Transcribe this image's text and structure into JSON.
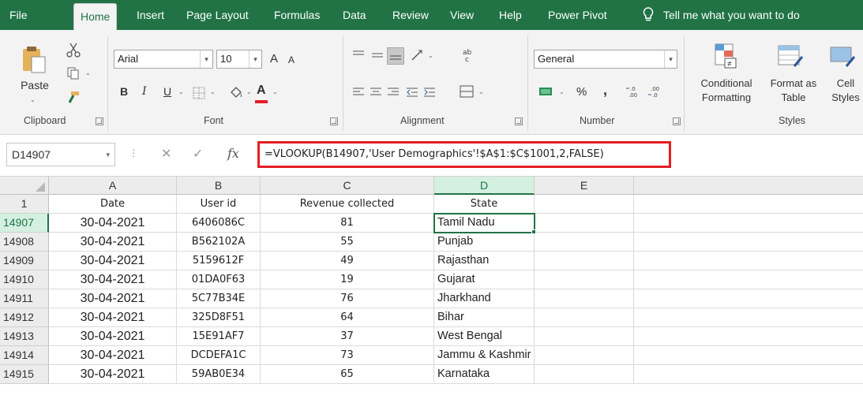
{
  "menu": {
    "tabs": [
      "File",
      "Home",
      "Insert",
      "Page Layout",
      "Formulas",
      "Data",
      "Review",
      "View",
      "Help",
      "Power Pivot"
    ],
    "active_tab": "Home",
    "tell_me": "Tell me what you want to do"
  },
  "ribbon": {
    "clipboard": {
      "paste": "Paste",
      "label": "Clipboard"
    },
    "font": {
      "name": "Arial",
      "size": "10",
      "bold": "B",
      "italic": "I",
      "underline": "U",
      "font_color_letter": "A",
      "grow": "A",
      "shrink": "A",
      "label": "Font"
    },
    "alignment": {
      "label": "Alignment"
    },
    "number": {
      "format": "General",
      "percent": "%",
      "comma": ",",
      "label": "Number"
    },
    "styles": {
      "conditional": "Conditional",
      "conditional2": "Formatting",
      "format_as": "Format as",
      "format_as2": "Table",
      "cell": "Cell",
      "cell2": "Styles",
      "label": "Styles"
    }
  },
  "formula_bar": {
    "name_box": "D14907",
    "fx": "fx",
    "cancel": "✕",
    "enter": "✓",
    "formula": "=VLOOKUP(B14907,'User Demographics'!$A$1:$C$1001,2,FALSE)"
  },
  "grid": {
    "columns": [
      "A",
      "B",
      "C",
      "D",
      "E"
    ],
    "selected_column": "D",
    "header_row": {
      "number": "1",
      "cells": [
        "Date",
        "User id",
        "Revenue collected",
        "State"
      ]
    },
    "rows": [
      {
        "num": "14907",
        "date": "30-04-2021",
        "uid": "6406086C",
        "rev": "81",
        "state": "Tamil Nadu"
      },
      {
        "num": "14908",
        "date": "30-04-2021",
        "uid": "B562102A",
        "rev": "55",
        "state": "Punjab"
      },
      {
        "num": "14909",
        "date": "30-04-2021",
        "uid": "5159612F",
        "rev": "49",
        "state": "Rajasthan"
      },
      {
        "num": "14910",
        "date": "30-04-2021",
        "uid": "01DA0F63",
        "rev": "19",
        "state": "Gujarat"
      },
      {
        "num": "14911",
        "date": "30-04-2021",
        "uid": "5C77B34E",
        "rev": "76",
        "state": "Jharkhand"
      },
      {
        "num": "14912",
        "date": "30-04-2021",
        "uid": "325D8F51",
        "rev": "64",
        "state": "Bihar"
      },
      {
        "num": "14913",
        "date": "30-04-2021",
        "uid": "15E91AF7",
        "rev": "37",
        "state": "West Bengal"
      },
      {
        "num": "14914",
        "date": "30-04-2021",
        "uid": "DCDEFA1C",
        "rev": "73",
        "state": "Jammu & Kashmir"
      },
      {
        "num": "14915",
        "date": "30-04-2021",
        "uid": "59AB0E34",
        "rev": "65",
        "state": "Karnataka"
      }
    ]
  },
  "colors": {
    "excel_green": "#217346",
    "highlight_red": "#e31e24",
    "font_red": "#e31e24"
  }
}
